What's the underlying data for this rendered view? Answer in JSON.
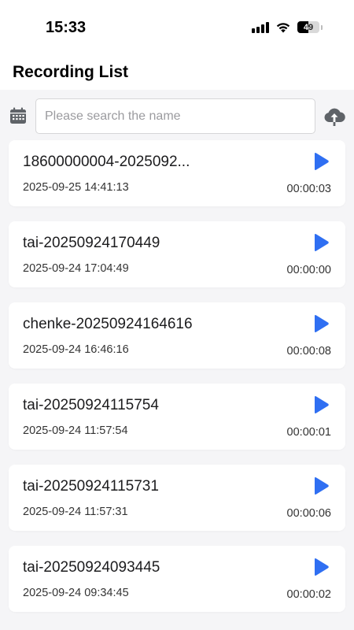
{
  "status_bar": {
    "time": "15:33",
    "battery": "49",
    "battery_level": 0.49
  },
  "header": {
    "title": "Recording List"
  },
  "search": {
    "placeholder": "Please search the name",
    "value": ""
  },
  "icons": {
    "calendar": "calendar-icon",
    "upload": "cloud-upload-icon",
    "play": "play-icon"
  },
  "colors": {
    "accent": "#2f6ff2",
    "background": "#f5f5f7",
    "card": "#ffffff"
  },
  "recordings": [
    {
      "name": "18600000004-2025092...",
      "date": "2025-09-25 14:41:13",
      "duration": "00:00:03"
    },
    {
      "name": "tai-20250924170449",
      "date": "2025-09-24 17:04:49",
      "duration": "00:00:00"
    },
    {
      "name": "chenke-20250924164616",
      "date": "2025-09-24 16:46:16",
      "duration": "00:00:08"
    },
    {
      "name": "tai-20250924115754",
      "date": "2025-09-24 11:57:54",
      "duration": "00:00:01"
    },
    {
      "name": "tai-20250924115731",
      "date": "2025-09-24 11:57:31",
      "duration": "00:00:06"
    },
    {
      "name": "tai-20250924093445",
      "date": "2025-09-24 09:34:45",
      "duration": "00:00:02"
    }
  ]
}
